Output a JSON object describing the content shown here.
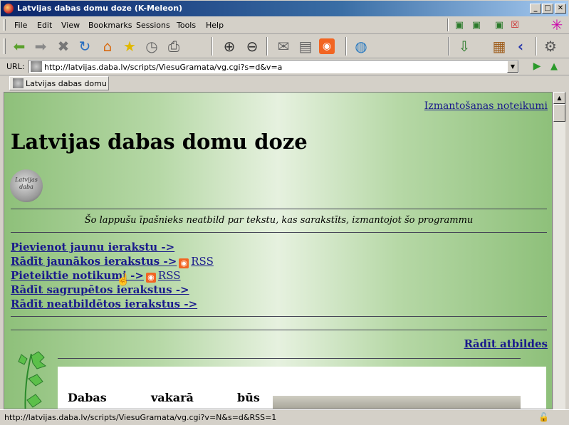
{
  "window": {
    "title": "Latvijas dabas domu doze (K-Meleon)",
    "minimize": "_",
    "maximize": "□",
    "close": "✕"
  },
  "menu": [
    "File",
    "Edit",
    "View",
    "Bookmarks",
    "Sessions",
    "Tools",
    "Help"
  ],
  "url_bar": {
    "label": "URL:",
    "value": "http://latvijas.daba.lv/scripts/ViesuGramata/vg.cgi?s=d&v=a"
  },
  "tab": {
    "label": "Latvijas dabas domu ..."
  },
  "page": {
    "terms_link": "Izmantošanas noteikumi",
    "heading": "Latvijas dabas domu doze",
    "logo_text": "Latvijas daba",
    "notice": "Šo lappušu īpašnieks neatbild par tekstu, kas sarakstīts, izmantojot šo programmu",
    "links": [
      {
        "text": "Pievienot jaunu ierakstu ->"
      },
      {
        "text": "Rādīt jaunākos ierakstus ->",
        "rss": "RSS"
      },
      {
        "text": "Pieteiktie notikumi ->",
        "rss": "RSS"
      },
      {
        "text": "Rādīt sagrupētos ierakstus ->"
      },
      {
        "text": "Rādīt neatbildētos ierakstus ->"
      }
    ],
    "show_answers": "Rādīt atbildes",
    "entry_words": [
      "Dabas",
      "vakarā",
      "būs"
    ]
  },
  "status": {
    "text": "http://latvijas.daba.lv/scripts/ViesuGramata/vg.cgi?v=N&s=d&RSS=1"
  },
  "colors": {
    "link": "#1a1a8c",
    "bg_green": "#8ec07a",
    "titlebar": "#0a246a"
  }
}
